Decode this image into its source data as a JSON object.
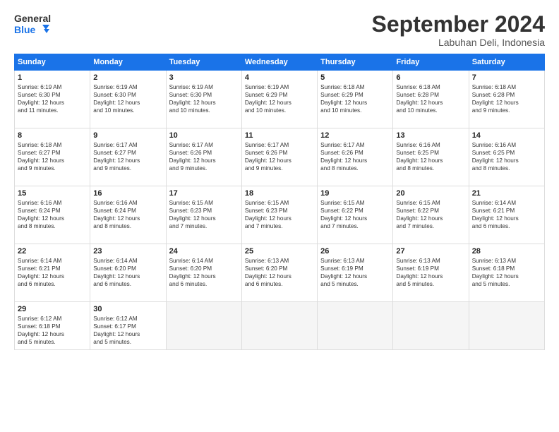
{
  "logo": {
    "line1": "General",
    "line2": "Blue"
  },
  "title": "September 2024",
  "location": "Labuhan Deli, Indonesia",
  "days_header": [
    "Sunday",
    "Monday",
    "Tuesday",
    "Wednesday",
    "Thursday",
    "Friday",
    "Saturday"
  ],
  "weeks": [
    [
      {
        "day": "1",
        "info": "Sunrise: 6:19 AM\nSunset: 6:30 PM\nDaylight: 12 hours\nand 11 minutes."
      },
      {
        "day": "2",
        "info": "Sunrise: 6:19 AM\nSunset: 6:30 PM\nDaylight: 12 hours\nand 10 minutes."
      },
      {
        "day": "3",
        "info": "Sunrise: 6:19 AM\nSunset: 6:30 PM\nDaylight: 12 hours\nand 10 minutes."
      },
      {
        "day": "4",
        "info": "Sunrise: 6:19 AM\nSunset: 6:29 PM\nDaylight: 12 hours\nand 10 minutes."
      },
      {
        "day": "5",
        "info": "Sunrise: 6:18 AM\nSunset: 6:29 PM\nDaylight: 12 hours\nand 10 minutes."
      },
      {
        "day": "6",
        "info": "Sunrise: 6:18 AM\nSunset: 6:28 PM\nDaylight: 12 hours\nand 10 minutes."
      },
      {
        "day": "7",
        "info": "Sunrise: 6:18 AM\nSunset: 6:28 PM\nDaylight: 12 hours\nand 9 minutes."
      }
    ],
    [
      {
        "day": "8",
        "info": "Sunrise: 6:18 AM\nSunset: 6:27 PM\nDaylight: 12 hours\nand 9 minutes."
      },
      {
        "day": "9",
        "info": "Sunrise: 6:17 AM\nSunset: 6:27 PM\nDaylight: 12 hours\nand 9 minutes."
      },
      {
        "day": "10",
        "info": "Sunrise: 6:17 AM\nSunset: 6:26 PM\nDaylight: 12 hours\nand 9 minutes."
      },
      {
        "day": "11",
        "info": "Sunrise: 6:17 AM\nSunset: 6:26 PM\nDaylight: 12 hours\nand 9 minutes."
      },
      {
        "day": "12",
        "info": "Sunrise: 6:17 AM\nSunset: 6:26 PM\nDaylight: 12 hours\nand 8 minutes."
      },
      {
        "day": "13",
        "info": "Sunrise: 6:16 AM\nSunset: 6:25 PM\nDaylight: 12 hours\nand 8 minutes."
      },
      {
        "day": "14",
        "info": "Sunrise: 6:16 AM\nSunset: 6:25 PM\nDaylight: 12 hours\nand 8 minutes."
      }
    ],
    [
      {
        "day": "15",
        "info": "Sunrise: 6:16 AM\nSunset: 6:24 PM\nDaylight: 12 hours\nand 8 minutes."
      },
      {
        "day": "16",
        "info": "Sunrise: 6:16 AM\nSunset: 6:24 PM\nDaylight: 12 hours\nand 8 minutes."
      },
      {
        "day": "17",
        "info": "Sunrise: 6:15 AM\nSunset: 6:23 PM\nDaylight: 12 hours\nand 7 minutes."
      },
      {
        "day": "18",
        "info": "Sunrise: 6:15 AM\nSunset: 6:23 PM\nDaylight: 12 hours\nand 7 minutes."
      },
      {
        "day": "19",
        "info": "Sunrise: 6:15 AM\nSunset: 6:22 PM\nDaylight: 12 hours\nand 7 minutes."
      },
      {
        "day": "20",
        "info": "Sunrise: 6:15 AM\nSunset: 6:22 PM\nDaylight: 12 hours\nand 7 minutes."
      },
      {
        "day": "21",
        "info": "Sunrise: 6:14 AM\nSunset: 6:21 PM\nDaylight: 12 hours\nand 6 minutes."
      }
    ],
    [
      {
        "day": "22",
        "info": "Sunrise: 6:14 AM\nSunset: 6:21 PM\nDaylight: 12 hours\nand 6 minutes."
      },
      {
        "day": "23",
        "info": "Sunrise: 6:14 AM\nSunset: 6:20 PM\nDaylight: 12 hours\nand 6 minutes."
      },
      {
        "day": "24",
        "info": "Sunrise: 6:14 AM\nSunset: 6:20 PM\nDaylight: 12 hours\nand 6 minutes."
      },
      {
        "day": "25",
        "info": "Sunrise: 6:13 AM\nSunset: 6:20 PM\nDaylight: 12 hours\nand 6 minutes."
      },
      {
        "day": "26",
        "info": "Sunrise: 6:13 AM\nSunset: 6:19 PM\nDaylight: 12 hours\nand 5 minutes."
      },
      {
        "day": "27",
        "info": "Sunrise: 6:13 AM\nSunset: 6:19 PM\nDaylight: 12 hours\nand 5 minutes."
      },
      {
        "day": "28",
        "info": "Sunrise: 6:13 AM\nSunset: 6:18 PM\nDaylight: 12 hours\nand 5 minutes."
      }
    ],
    [
      {
        "day": "29",
        "info": "Sunrise: 6:12 AM\nSunset: 6:18 PM\nDaylight: 12 hours\nand 5 minutes."
      },
      {
        "day": "30",
        "info": "Sunrise: 6:12 AM\nSunset: 6:17 PM\nDaylight: 12 hours\nand 5 minutes."
      },
      {
        "day": "",
        "info": ""
      },
      {
        "day": "",
        "info": ""
      },
      {
        "day": "",
        "info": ""
      },
      {
        "day": "",
        "info": ""
      },
      {
        "day": "",
        "info": ""
      }
    ]
  ]
}
